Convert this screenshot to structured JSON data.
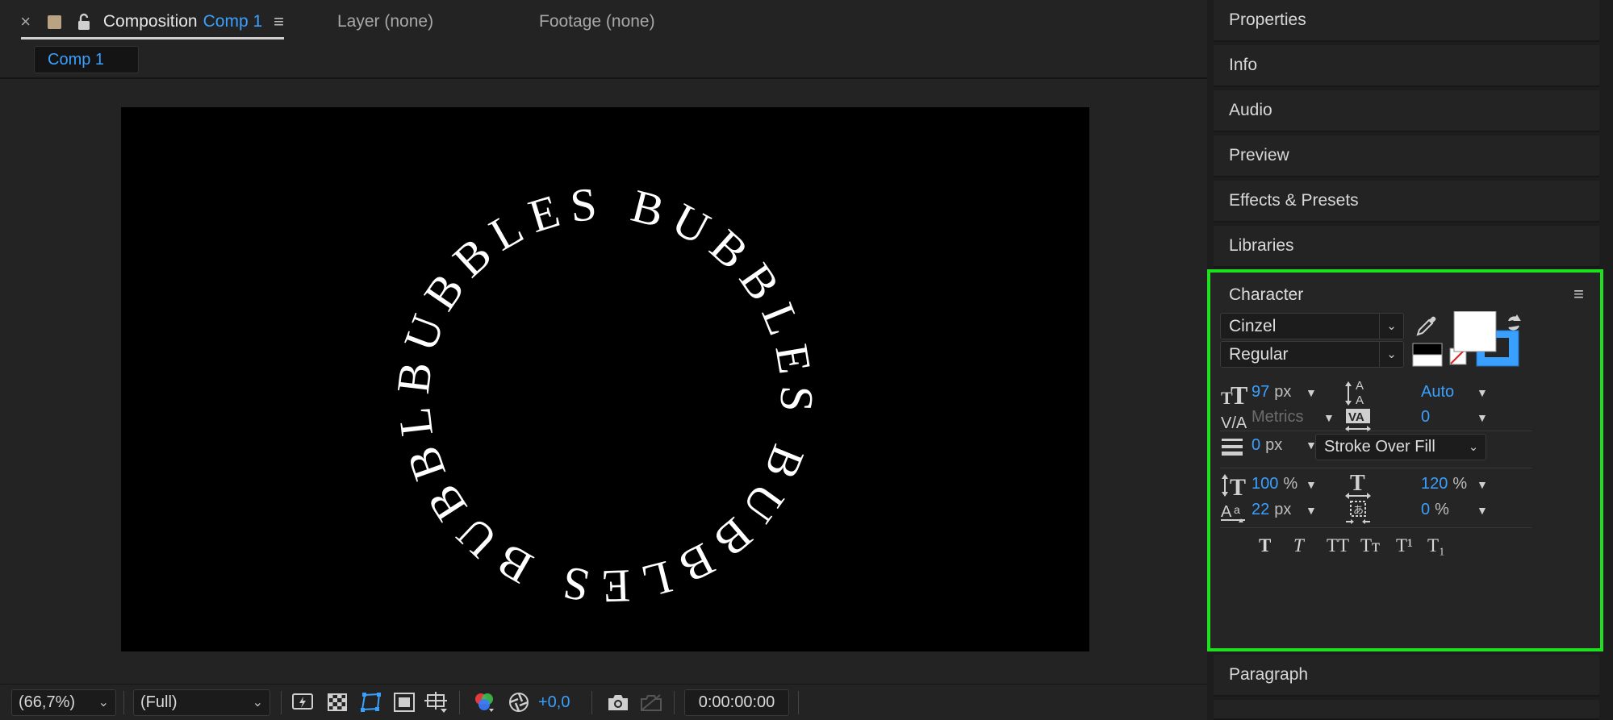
{
  "composition_panel": {
    "tabs": {
      "composition": {
        "prefix": "Composition",
        "name": "Comp 1"
      },
      "layer": "Layer (none)",
      "footage": "Footage (none)"
    },
    "subtab": "Comp 1",
    "canvas_text": {
      "word": "BUBBLES",
      "text": "BUBBLES BUBBLES BUBBLES BUBBLES"
    },
    "footer": {
      "zoom": "(66,7%)",
      "resolution": "(Full)",
      "exposure": "+0,0",
      "timecode": "0:00:00:00"
    }
  },
  "right_panels": {
    "properties": "Properties",
    "info": "Info",
    "audio": "Audio",
    "preview": "Preview",
    "effects_presets": "Effects & Presets",
    "libraries": "Libraries",
    "paragraph": "Paragraph"
  },
  "character": {
    "title": "Character",
    "font_family": "Cinzel",
    "font_style": "Regular",
    "fill_color": "#ffffff",
    "stroke_color": "#3aa0ff",
    "font_size": {
      "value": "97",
      "unit": "px"
    },
    "leading": {
      "value": "Auto"
    },
    "kerning": {
      "value": "Metrics"
    },
    "tracking": {
      "value": "0"
    },
    "stroke_width": {
      "value": "0",
      "unit": "px"
    },
    "stroke_style": "Stroke Over Fill",
    "vertical_scale": {
      "value": "100",
      "unit": "%"
    },
    "horizontal_scale": {
      "value": "120",
      "unit": "%"
    },
    "baseline_shift": {
      "value": "22",
      "unit": "px"
    },
    "tsume": {
      "value": "0",
      "unit": "%"
    },
    "styles": [
      "T",
      "T",
      "TT",
      "Tт",
      "T¹",
      "T₁"
    ]
  },
  "highlight_color": "#1ee01e"
}
